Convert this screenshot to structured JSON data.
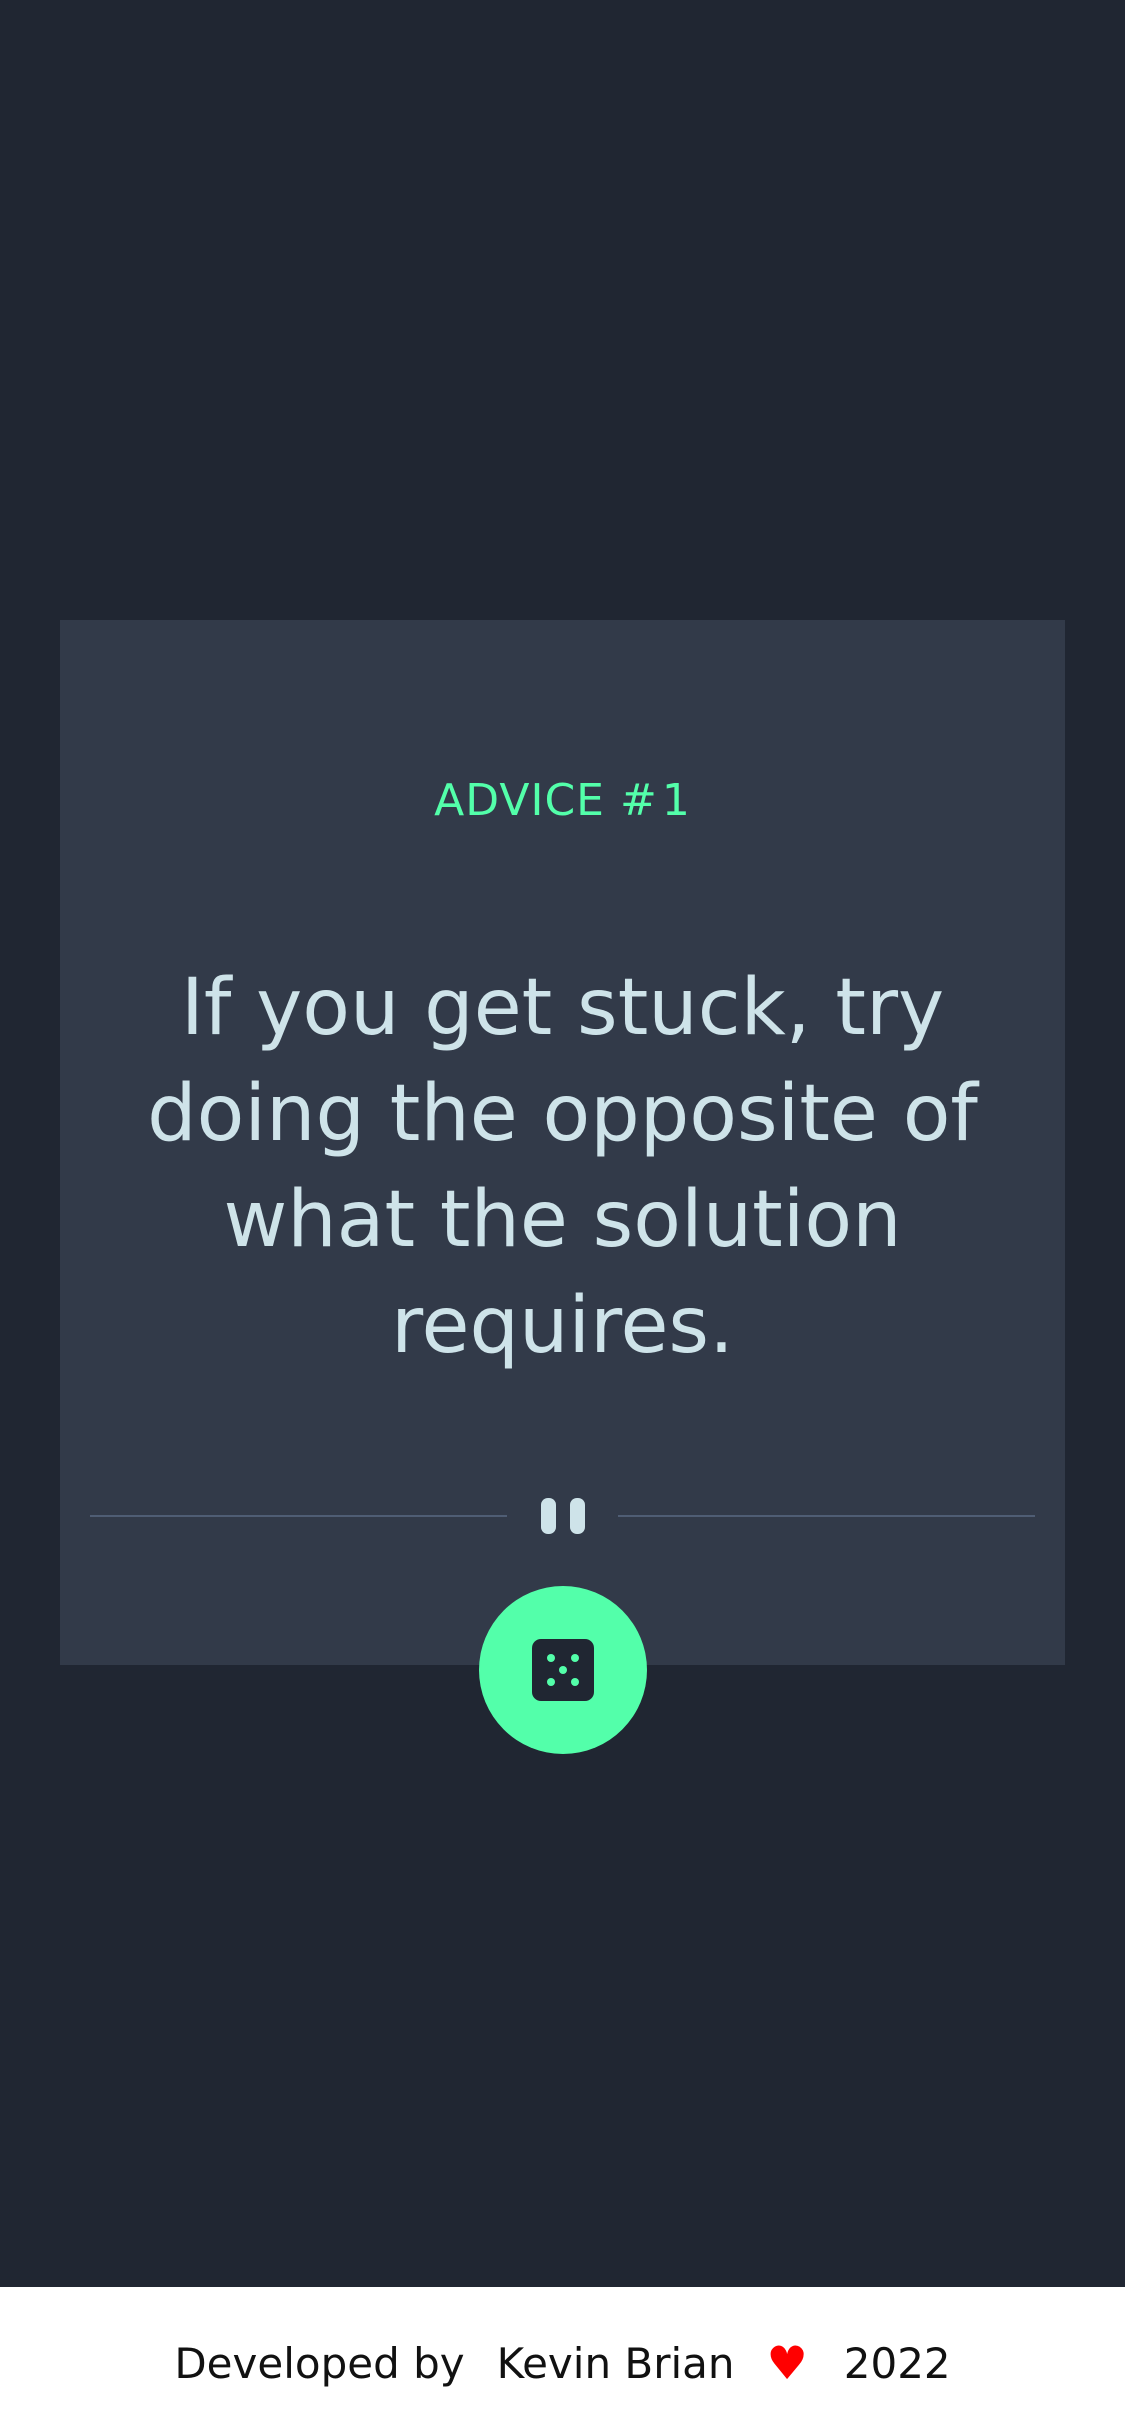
{
  "card": {
    "advice_label": "ADVICE #",
    "advice_number": "1",
    "quote": "If you get stuck, try doing the opposite of what the solution requires."
  },
  "icons": {
    "divider": "pause-icon",
    "button": "dice-icon",
    "footer": "heart-icon"
  },
  "colors": {
    "background": "#202632",
    "card": "#323A49",
    "accent": "#53FFAA",
    "quote_text": "#CEE3E9",
    "heart": "#FF0000"
  },
  "footer": {
    "prefix": "Developed by",
    "author": "Kevin Brian",
    "heart": "♥",
    "year": "2022"
  }
}
